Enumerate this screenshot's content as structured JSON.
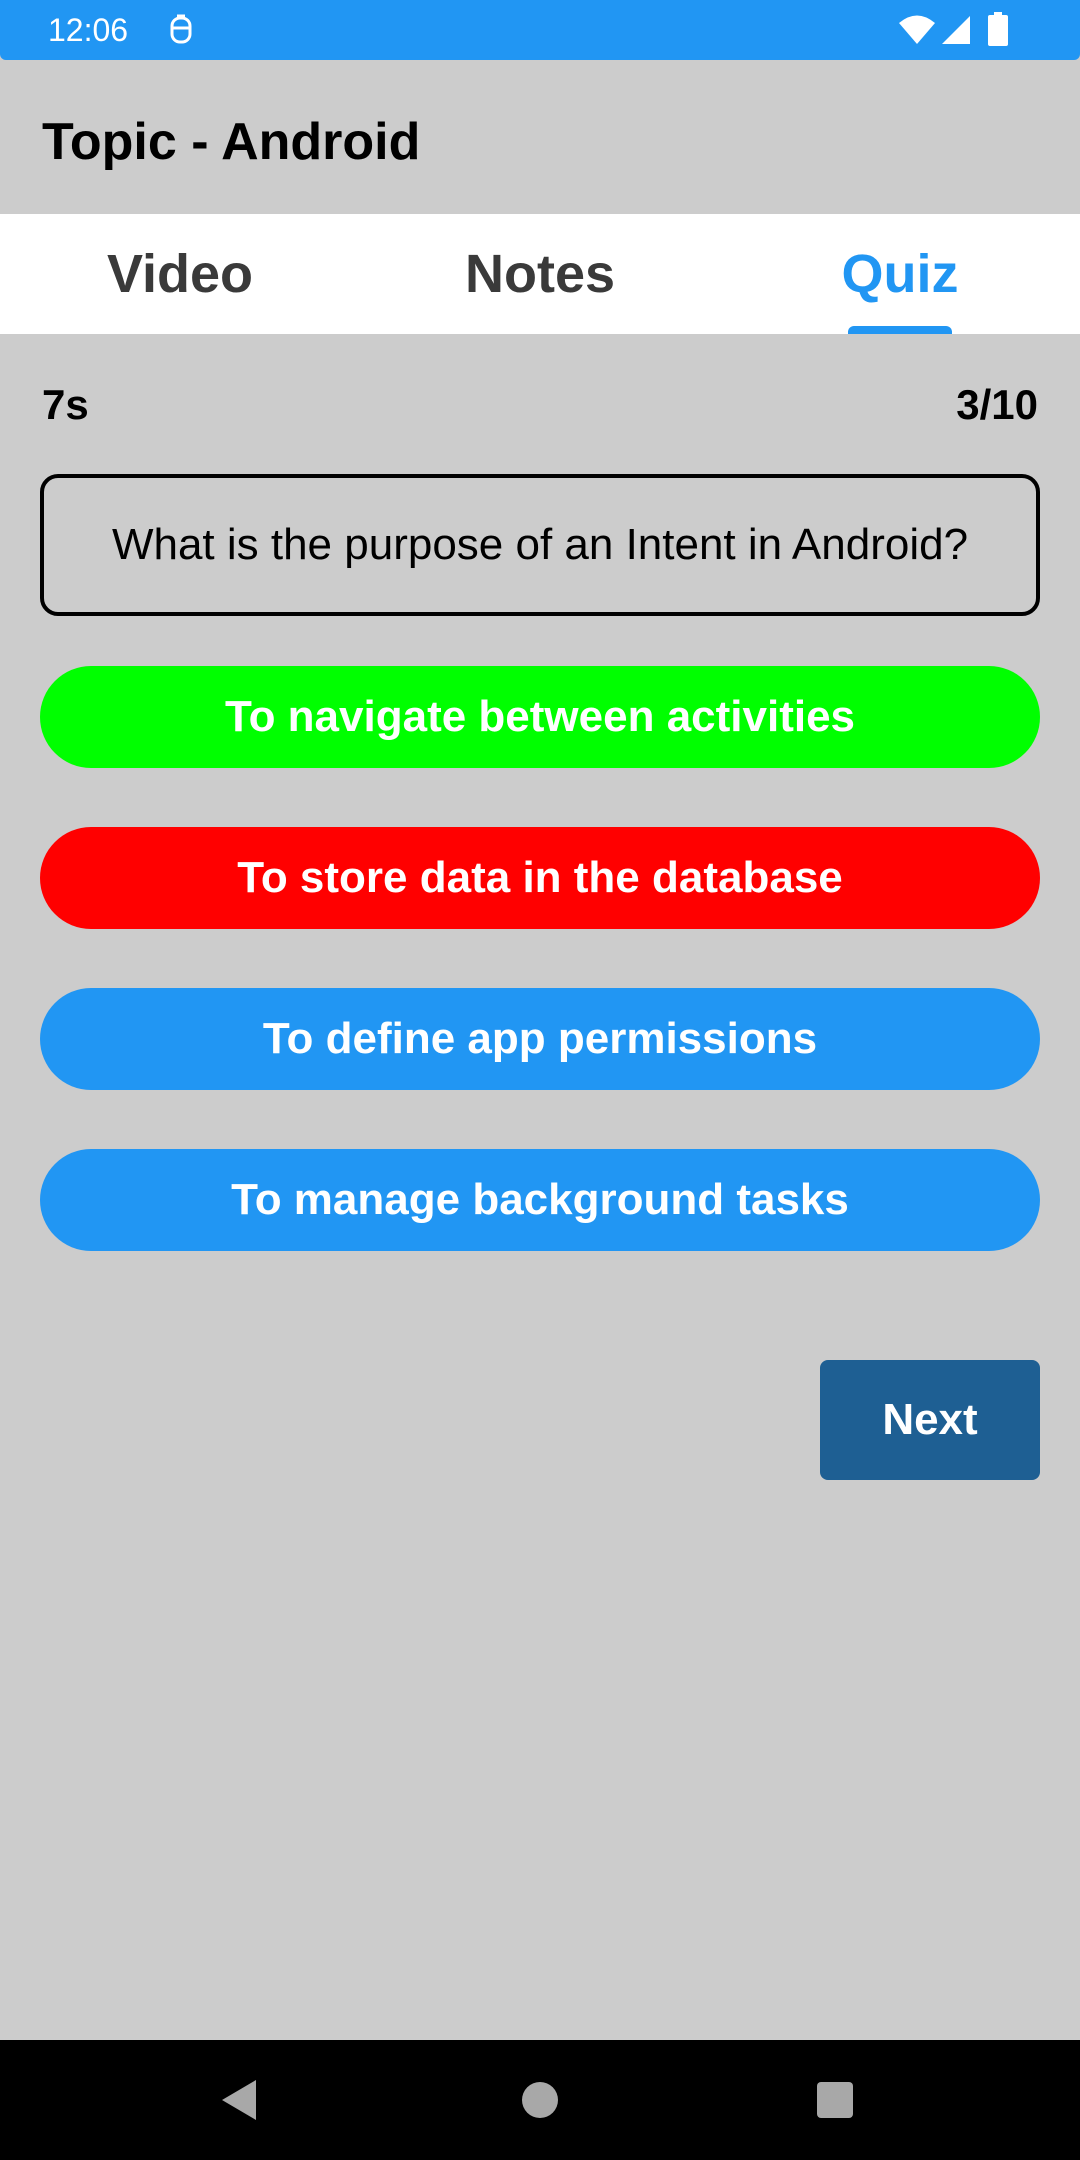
{
  "status_bar": {
    "time": "12:06",
    "icons": [
      "notification-icon",
      "wifi-icon",
      "signal-icon",
      "battery-icon"
    ]
  },
  "app_bar": {
    "title": "Topic - Android"
  },
  "tabs": [
    {
      "label": "Video",
      "selected": false
    },
    {
      "label": "Notes",
      "selected": false
    },
    {
      "label": "Quiz",
      "selected": true
    }
  ],
  "quiz": {
    "timer": "7s",
    "progress": "3/10",
    "question": "What is the purpose of an Intent in Android?",
    "answers": [
      {
        "label": "To navigate between activities",
        "state": "correct",
        "color": "#00ff00"
      },
      {
        "label": "To store data in the database",
        "state": "incorrect",
        "color": "#ff0000"
      },
      {
        "label": "To define app permissions",
        "state": "default",
        "color": "#2196f3"
      },
      {
        "label": "To manage background tasks",
        "state": "default",
        "color": "#2196f3"
      }
    ],
    "next_label": "Next"
  },
  "colors": {
    "accent": "#2196f3",
    "background": "#cccccc",
    "next_button": "#1e5f93",
    "correct": "#00ff00",
    "incorrect": "#ff0000"
  },
  "nav_bar": {
    "icons": [
      "back-icon",
      "home-icon",
      "recents-icon"
    ]
  }
}
